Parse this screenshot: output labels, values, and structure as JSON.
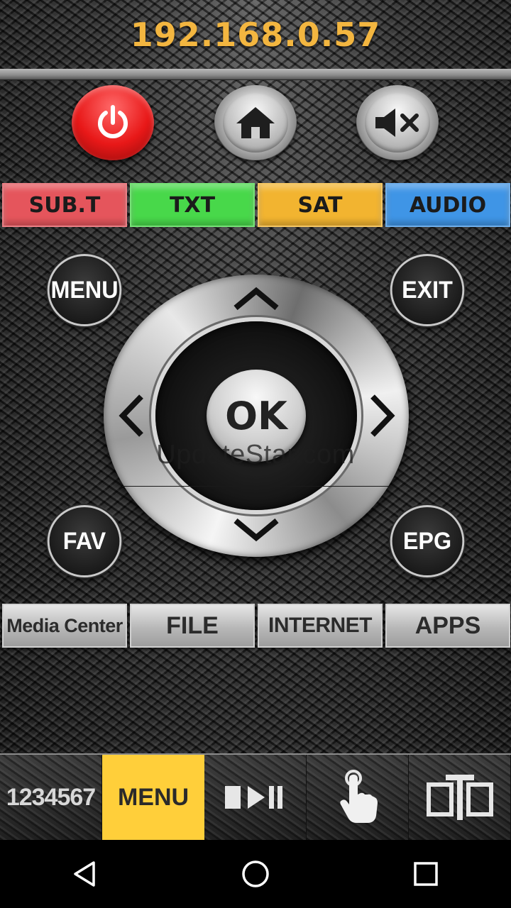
{
  "header": {
    "ip_address": "192.168.0.57"
  },
  "top_buttons": {
    "power": "power-icon",
    "home": "home-icon",
    "mute": "mute-icon"
  },
  "color_buttons": [
    {
      "label": "SUB.T",
      "color": "#e5555c"
    },
    {
      "label": "TXT",
      "color": "#48d84a"
    },
    {
      "label": "SAT",
      "color": "#f2b430"
    },
    {
      "label": "AUDIO",
      "color": "#3f95e6"
    }
  ],
  "side_buttons": {
    "menu": "MENU",
    "exit": "EXIT",
    "fav": "FAV",
    "epg": "EPG"
  },
  "dpad": {
    "ok_label": "OK",
    "up": "chevron-up-icon",
    "down": "chevron-down-icon",
    "left": "chevron-left-icon",
    "right": "chevron-right-icon"
  },
  "watermark": "UpdateStar.com",
  "function_buttons": [
    {
      "label": "Media Center"
    },
    {
      "label": "FILE"
    },
    {
      "label": "INTERNET"
    },
    {
      "label": "APPS"
    }
  ],
  "tabs": [
    {
      "label": "1234567"
    },
    {
      "label": "MENU",
      "active": true
    },
    {
      "icon": "play-pause-icon"
    },
    {
      "icon": "touch-icon"
    },
    {
      "icon": "screen-mirror-icon"
    }
  ],
  "accent_color": "#ffcf3a",
  "ip_color": "#f3b640"
}
